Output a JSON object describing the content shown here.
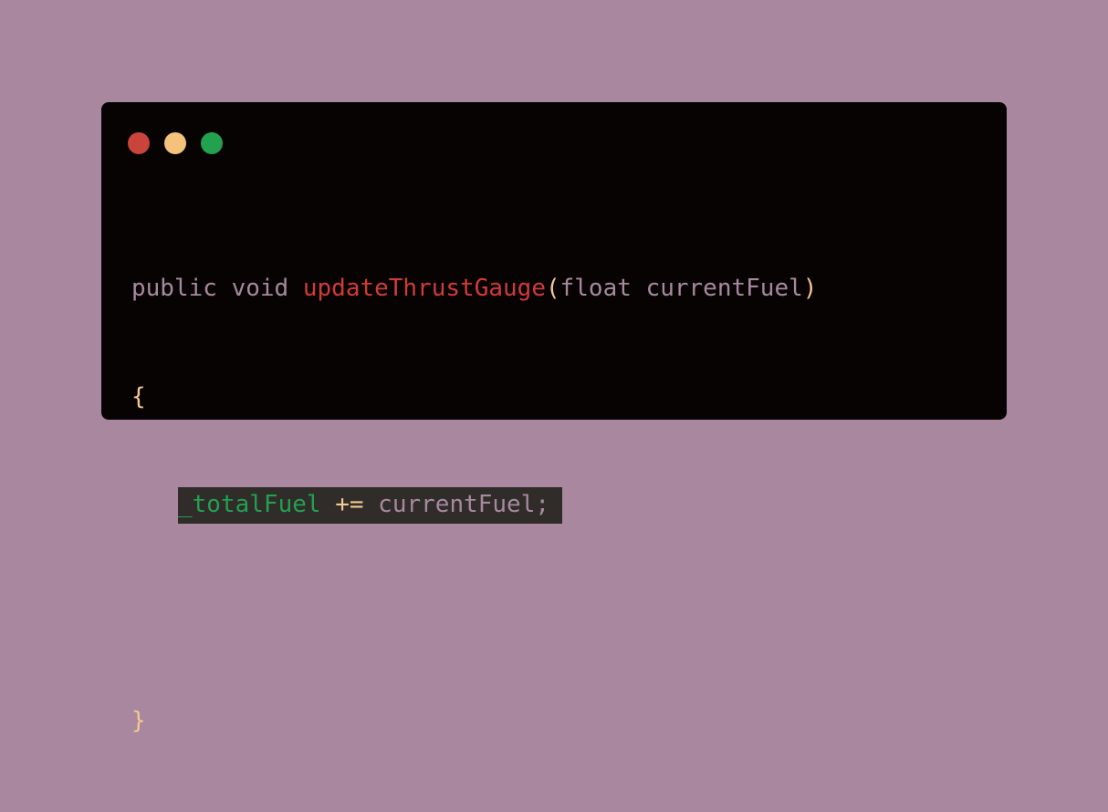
{
  "colors": {
    "background": "#a8879f",
    "window": "#070303",
    "keyword": "#a7899f",
    "function": "#d13b36",
    "punctuation": "#f4c891",
    "field": "#23a050",
    "operator": "#f4c891",
    "identifier": "#a7899f",
    "highlight": "#2f2c29"
  },
  "window_controls": [
    {
      "name": "close",
      "color": "#c9443a"
    },
    {
      "name": "minimize",
      "color": "#f4c27a"
    },
    {
      "name": "maximize",
      "color": "#22a24e"
    }
  ],
  "code": {
    "line1": {
      "indent": " ",
      "kw_public": "public",
      "kw_void": "void",
      "fn_name": "updateThrustGauge",
      "paren_open": "(",
      "kw_float": "float",
      "param": "currentFuel",
      "paren_close": ")"
    },
    "line2": {
      "brace_open": "{"
    },
    "line3": {
      "indent": "   ",
      "field": "_totalFuel",
      "op": "+=",
      "ident": "currentFuel;"
    },
    "line5": {
      "brace_close": "}"
    }
  }
}
